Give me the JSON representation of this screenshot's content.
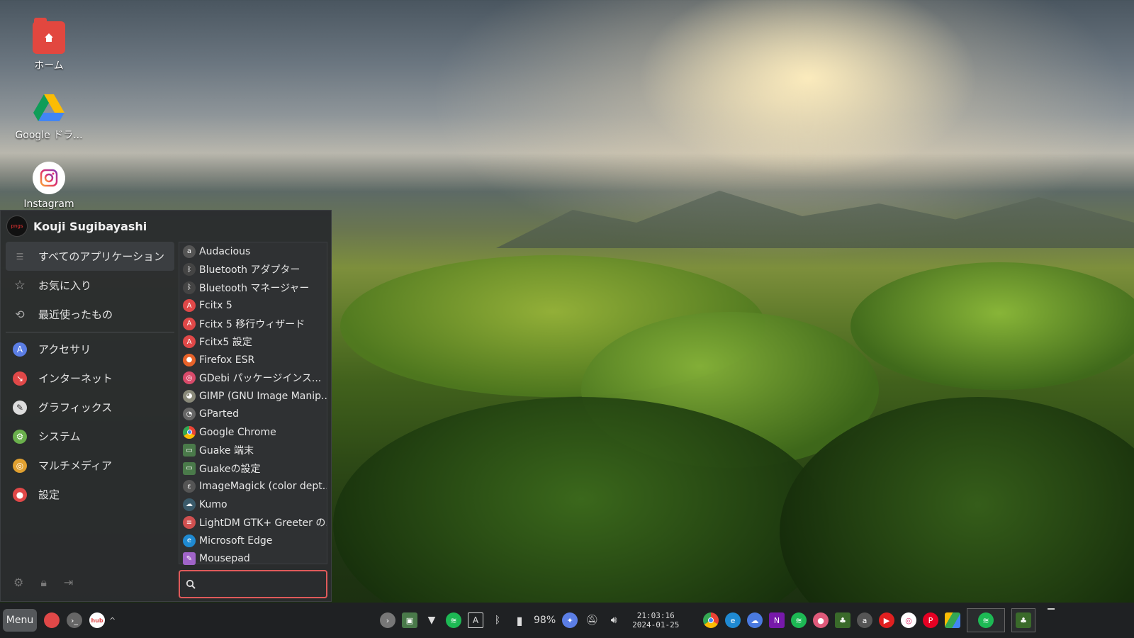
{
  "desktop": {
    "icons": [
      {
        "label": "ホーム",
        "icon": "home-folder-icon"
      },
      {
        "label": "Google ドラ...",
        "icon": "google-drive-icon"
      },
      {
        "label": "Instagram",
        "icon": "instagram-icon"
      }
    ]
  },
  "menu": {
    "username": "Kouji Sugibayashi",
    "avatar_text": "pngs",
    "categories": [
      {
        "label": "すべてのアプリケーション",
        "icon": "list-icon",
        "active": true
      },
      {
        "label": "お気に入り",
        "icon": "star-icon"
      },
      {
        "label": "最近使ったもの",
        "icon": "history-icon"
      },
      {
        "label": "アクセサリ",
        "icon": "accessories-icon",
        "color": "#5b7ee5"
      },
      {
        "label": "インターネット",
        "icon": "internet-icon",
        "color": "#e04848"
      },
      {
        "label": "グラフィックス",
        "icon": "graphics-icon",
        "color": "#dddddd"
      },
      {
        "label": "システム",
        "icon": "system-icon",
        "color": "#6ab04c"
      },
      {
        "label": "マルチメディア",
        "icon": "multimedia-icon",
        "color": "#e0a030"
      },
      {
        "label": "設定",
        "icon": "settings-icon",
        "color": "#e04848"
      }
    ],
    "apps": [
      {
        "label": "Audacious",
        "icon": "audacious-icon",
        "color": "#555555"
      },
      {
        "label": "Bluetooth アダプター",
        "icon": "bluetooth-icon",
        "color": "#444444"
      },
      {
        "label": "Bluetooth マネージャー",
        "icon": "bluetooth-icon",
        "color": "#444444"
      },
      {
        "label": "Fcitx 5",
        "icon": "fcitx-icon",
        "color": "#e04848"
      },
      {
        "label": "Fcitx 5 移行ウィザード",
        "icon": "fcitx-icon",
        "color": "#e04848"
      },
      {
        "label": "Fcitx5 設定",
        "icon": "fcitx-icon",
        "color": "#e04848"
      },
      {
        "label": "Firefox ESR",
        "icon": "firefox-icon",
        "color": "#e8632a"
      },
      {
        "label": "GDebi パッケージインス...",
        "icon": "gdebi-icon",
        "color": "#d84a6a"
      },
      {
        "label": "GIMP (GNU Image Manip...",
        "icon": "gimp-icon",
        "color": "#8a8a7a"
      },
      {
        "label": "GParted",
        "icon": "gparted-icon",
        "color": "#666666"
      },
      {
        "label": "Google Chrome",
        "icon": "chrome-icon",
        "color": "#3b8ee8"
      },
      {
        "label": "Guake 端末",
        "icon": "guake-icon",
        "color": "#4a7a4a"
      },
      {
        "label": "Guakeの設定",
        "icon": "guake-icon",
        "color": "#4a7a4a"
      },
      {
        "label": "ImageMagick (color dept...",
        "icon": "imagemagick-icon",
        "color": "#555555"
      },
      {
        "label": "Kumo",
        "icon": "kumo-icon",
        "color": "#3a5a6a"
      },
      {
        "label": "LightDM GTK+ Greeter の...",
        "icon": "lightdm-icon",
        "color": "#d05050"
      },
      {
        "label": "Microsoft Edge",
        "icon": "edge-icon",
        "color": "#1f8ad2"
      },
      {
        "label": "Mousepad",
        "icon": "mousepad-icon",
        "color": "#a064c8"
      }
    ],
    "search_placeholder": "",
    "footer": [
      "settings-gear-icon",
      "lock-icon",
      "logout-icon"
    ]
  },
  "taskbar": {
    "menu_label": "Menu",
    "battery_percent": "98%",
    "clock_time": "21:03:16",
    "clock_date": "2024-01-25",
    "ime_label": "A"
  }
}
